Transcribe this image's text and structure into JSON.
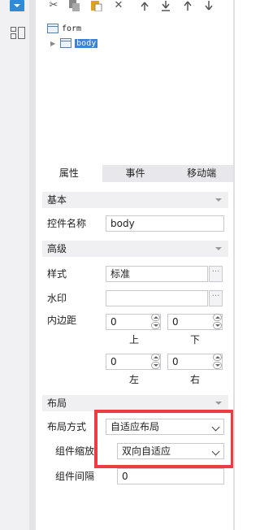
{
  "tree": {
    "root_label": "form",
    "child_label": "body"
  },
  "tabs": [
    {
      "label": "属性",
      "active": true
    },
    {
      "label": "事件",
      "active": false
    },
    {
      "label": "移动端",
      "active": false
    }
  ],
  "sections": {
    "basic": {
      "title": "基本",
      "control_name_label": "控件名称",
      "control_name_value": "body"
    },
    "advanced": {
      "title": "高级",
      "style_label": "样式",
      "style_value": "标准",
      "watermark_label": "水印",
      "watermark_value": "",
      "padding_label": "内边距",
      "padding_top": "0",
      "padding_bottom": "0",
      "padding_left": "0",
      "padding_right": "0",
      "top_label": "上",
      "bottom_label": "下",
      "left_label": "左",
      "right_label": "右"
    },
    "layout": {
      "title": "布局",
      "mode_label": "布局方式",
      "mode_value": "自适应布局",
      "scale_label": "组件缩放",
      "scale_value": "双向自适应",
      "gap_label": "组件间隔",
      "gap_value": "0"
    }
  },
  "ellipsis": "···",
  "icons": [
    "dropdown-icon",
    "layout-icon",
    "cut-icon",
    "copy-icon",
    "paste-icon",
    "delete-icon",
    "move-top-icon",
    "move-bottom-icon",
    "move-up-icon",
    "move-down-icon",
    "expand-arrow-icon"
  ],
  "colors": {
    "highlight": "#ec3b43",
    "selection": "#3f82d3"
  }
}
